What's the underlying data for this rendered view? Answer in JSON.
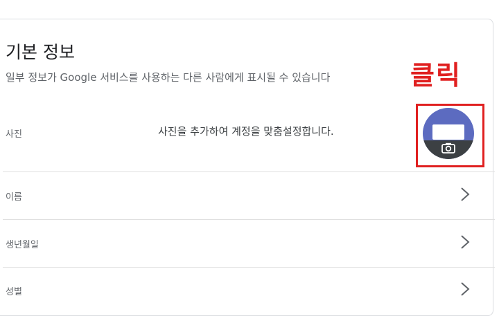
{
  "section": {
    "title": "기본 정보",
    "subtitle": "일부 정보가 Google 서비스를 사용하는 다른 사람에게 표시될 수 있습니다"
  },
  "annotation": {
    "text": "클릭",
    "color": "#e02020"
  },
  "rows": {
    "photo": {
      "label": "사진",
      "description": "사진을 추가하여 계정을 맞춤설정합니다."
    },
    "name": {
      "label": "이름"
    },
    "birthday": {
      "label": "생년월일"
    },
    "gender": {
      "label": "성별"
    }
  },
  "icons": {
    "avatar": "camera-icon",
    "row_chevron": "chevron-right-icon"
  },
  "colors": {
    "avatar_bg": "#5c6bc0",
    "avatar_bottom": "#3c4043",
    "highlight": "#e02020"
  }
}
